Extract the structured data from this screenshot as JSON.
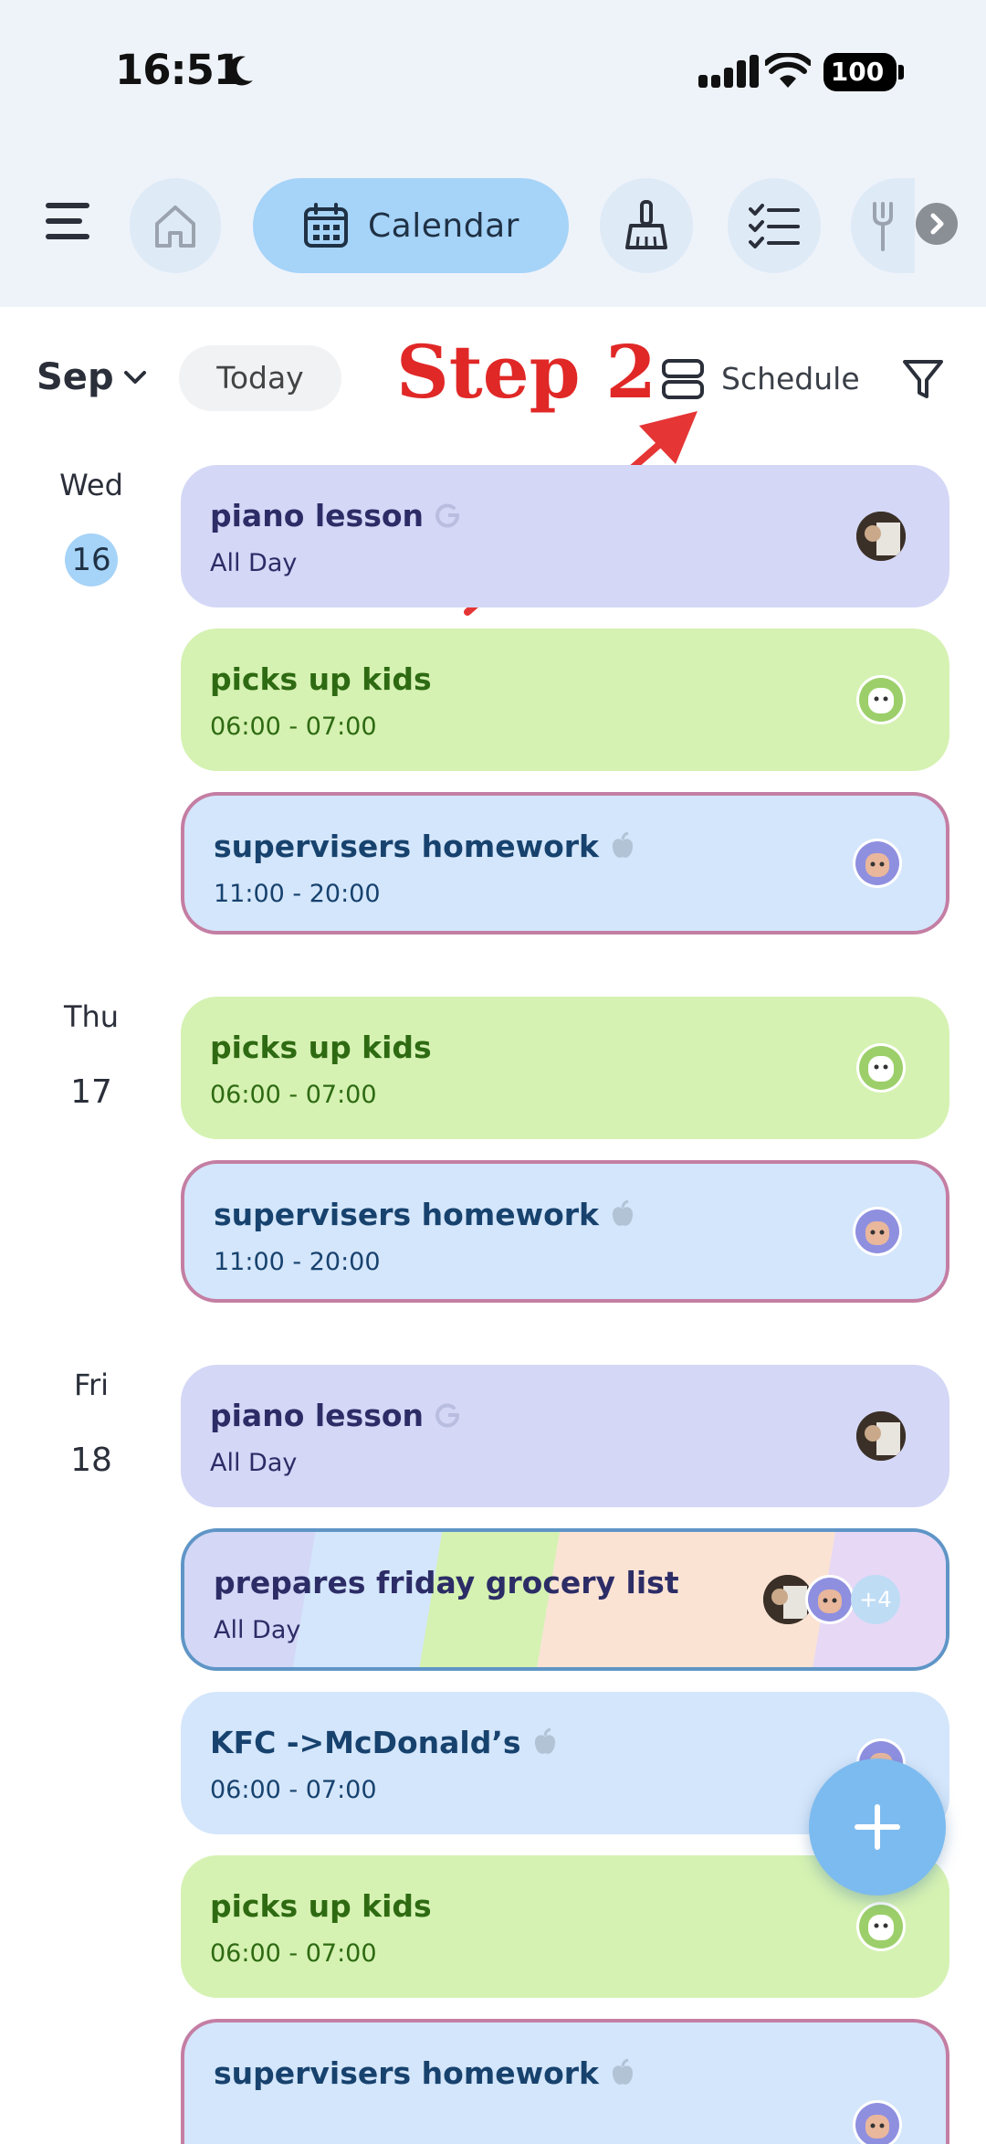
{
  "status_bar": {
    "time": "16:51",
    "battery": "100"
  },
  "nav": {
    "menu_icon": "hamburger-icon",
    "tabs": [
      {
        "id": "home",
        "icon": "home-icon",
        "label": ""
      },
      {
        "id": "calendar",
        "icon": "calendar-icon",
        "label": "Calendar",
        "active": true
      },
      {
        "id": "chores",
        "icon": "broom-icon",
        "label": ""
      },
      {
        "id": "tasks",
        "icon": "checklist-icon",
        "label": ""
      },
      {
        "id": "meals",
        "icon": "fork-icon",
        "label": ""
      }
    ],
    "more_icon": "chevron-right-icon"
  },
  "toolbar": {
    "month": "Sep",
    "today_label": "Today",
    "annotation": "Step 2",
    "view_label": "Schedule",
    "filter_icon": "filter-icon"
  },
  "colors": {
    "purple": "#d4d7f6",
    "green": "#d5f2b2",
    "blue": "#d4e6fb",
    "accent": "#a6d3f8",
    "annotation": "#e02827",
    "fab": "#7cbbef"
  },
  "days": [
    {
      "name": "Wed",
      "number": "16",
      "today": true,
      "events": [
        {
          "title": "piano lesson",
          "time": "All Day",
          "color": "purple",
          "source": "google-icon",
          "avatars": [
            "photo"
          ]
        },
        {
          "title": "picks up kids",
          "time": "06:00 - 07:00",
          "color": "green",
          "source": "",
          "avatars": [
            "green"
          ]
        },
        {
          "title": "supervisers homework",
          "time": "11:00 - 20:00",
          "color": "blue",
          "source": "apple-icon",
          "avatars": [
            "purple"
          ],
          "outline": "pink"
        }
      ]
    },
    {
      "name": "Thu",
      "number": "17",
      "events": [
        {
          "title": "picks up kids",
          "time": "06:00 - 07:00",
          "color": "green",
          "source": "",
          "avatars": [
            "green"
          ]
        },
        {
          "title": "supervisers homework",
          "time": "11:00 - 20:00",
          "color": "blue",
          "source": "apple-icon",
          "avatars": [
            "purple"
          ],
          "outline": "pink"
        }
      ]
    },
    {
      "name": "Fri",
      "number": "18",
      "events": [
        {
          "title": "piano lesson",
          "time": "All Day",
          "color": "purple",
          "source": "google-icon",
          "avatars": [
            "photo"
          ]
        },
        {
          "title": "prepares friday grocery list",
          "time": "All Day",
          "color": "multi",
          "source": "",
          "avatars": [
            "photo",
            "purple"
          ],
          "extra": "+4",
          "outline": "blue"
        },
        {
          "title": "KFC ->McDonald’s",
          "time": "06:00 - 07:00",
          "color": "blue",
          "source": "apple-icon",
          "avatars": [
            "purple"
          ]
        },
        {
          "title": "picks up kids",
          "time": "06:00 - 07:00",
          "color": "green",
          "source": "",
          "avatars": [
            "green"
          ]
        },
        {
          "title": "supervisers homework",
          "time": "",
          "color": "blue",
          "source": "apple-icon",
          "avatars": [
            "purple"
          ],
          "outline": "pink"
        }
      ]
    }
  ],
  "fab": {
    "icon": "plus-icon"
  }
}
